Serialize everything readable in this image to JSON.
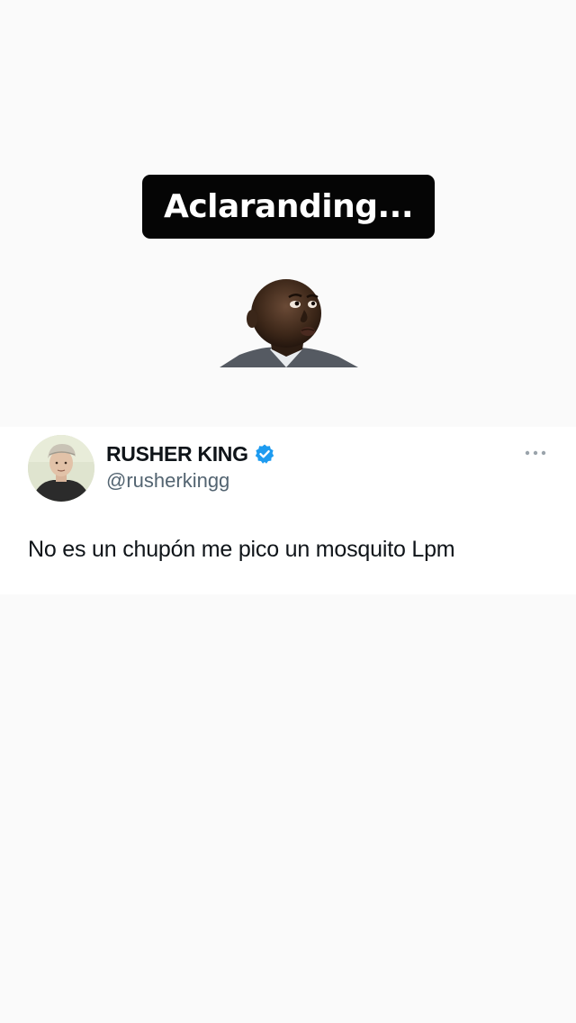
{
  "caption": {
    "text": "Aclaranding..."
  },
  "sticker": {
    "icon": "man-shrugging-sticker-icon"
  },
  "tweet": {
    "display_name": "RUSHER KING",
    "handle": "@rusherkingg",
    "verified_icon": "verified-badge-icon",
    "avatar_icon": "user-avatar-icon",
    "more_icon": "more-options-icon",
    "text": "No es un chupón me pico un mosquito Lpm",
    "verified_color": "#1d9bf0"
  }
}
